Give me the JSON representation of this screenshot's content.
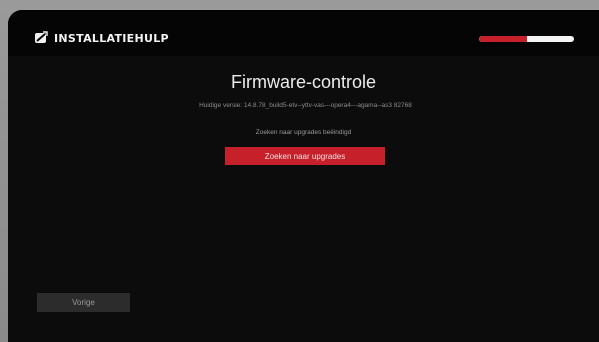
{
  "header": {
    "title": "INSTALLATIEHULP",
    "progress": 0.5,
    "colors": {
      "accent": "#c6202a",
      "track": "#f4f4f4"
    }
  },
  "main": {
    "title": "Firmware-controle",
    "version_text": "Huidige versie: 14.8.78_build5-etv--yttv-vas---opera4---agama--as3 82768",
    "status_text": "Zoeken naar upgrades beëindigd",
    "search_button_label": "Zoeken naar upgrades"
  },
  "footer": {
    "back_button_label": "Vorige"
  },
  "icons": {
    "brand": "wizard-icon"
  }
}
